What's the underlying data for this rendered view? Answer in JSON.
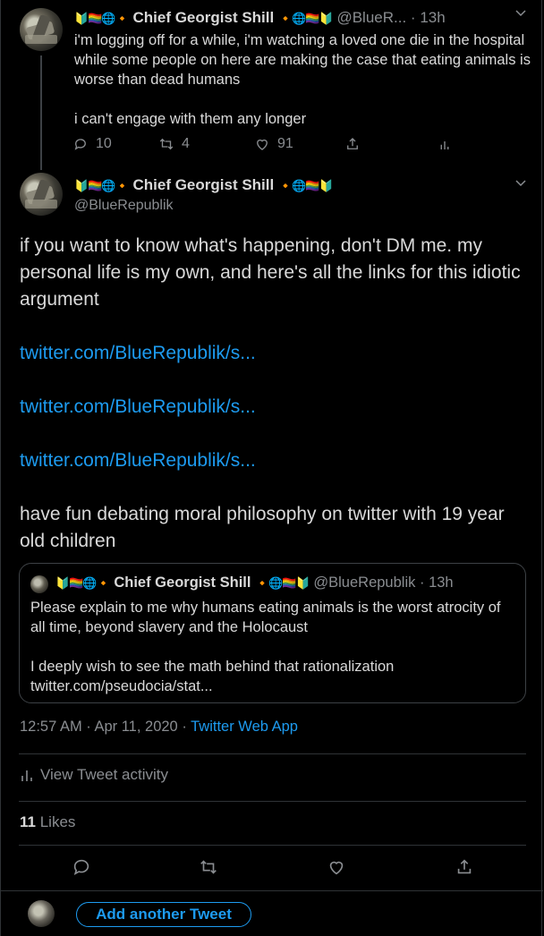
{
  "tweet1": {
    "emoji_left": "🔰🏳️‍🌈🌐🔸",
    "display_name": "Chief Georgist Shill",
    "emoji_right": "🔸🌐🏳️‍🌈🔰",
    "handle": "@BlueR...",
    "separator": "·",
    "time": "13h",
    "text": "i'm logging off for a while, i'm watching a loved one die in the hospital while some people on here are making the case that eating animals is worse than dead humans\n\ni can't engage with them any longer",
    "replies": "10",
    "retweets": "4",
    "likes": "91"
  },
  "tweet2": {
    "emoji_left": "🔰🏳️‍🌈🌐🔸",
    "display_name": "Chief Georgist Shill",
    "emoji_right": "🔸🌐🏳️‍🌈🔰",
    "handle": "@BlueRepublik",
    "paragraph1": "if you want to know what's happening, don't DM me. my personal life is my own, and here's all the links for this idiotic argument",
    "link1": "twitter.com/BlueRepublik/s...",
    "link2": "twitter.com/BlueRepublik/s...",
    "link3": "twitter.com/BlueRepublik/s...",
    "paragraph2": "have fun debating moral philosophy on twitter with 19 year old children",
    "quote": {
      "emoji_left": "🔰🏳️‍🌈🌐🔸",
      "display_name": "Chief Georgist Shill",
      "emoji_right": "🔸🌐🏳️‍🌈🔰",
      "handle": "@BlueRepublik",
      "separator": "·",
      "time": "13h",
      "line1": "Please explain to me why humans eating animals is the worst atrocity of all time, beyond slavery and the Holocaust",
      "line2": "I deeply wish to see the math behind that rationalization",
      "link": "twitter.com/pseudocia/stat..."
    },
    "timestamp": "12:57 AM · Apr 11, 2020",
    "dot": "·",
    "source": "Twitter Web App",
    "activity_label": "View Tweet activity",
    "likes_count": "11",
    "likes_label": "Likes"
  },
  "composer": {
    "add_label": "Add another Tweet"
  },
  "colors": {
    "background": "#000000",
    "accent": "#1d9bf0",
    "muted": "#8a8d91",
    "text": "#d9d9d9"
  }
}
